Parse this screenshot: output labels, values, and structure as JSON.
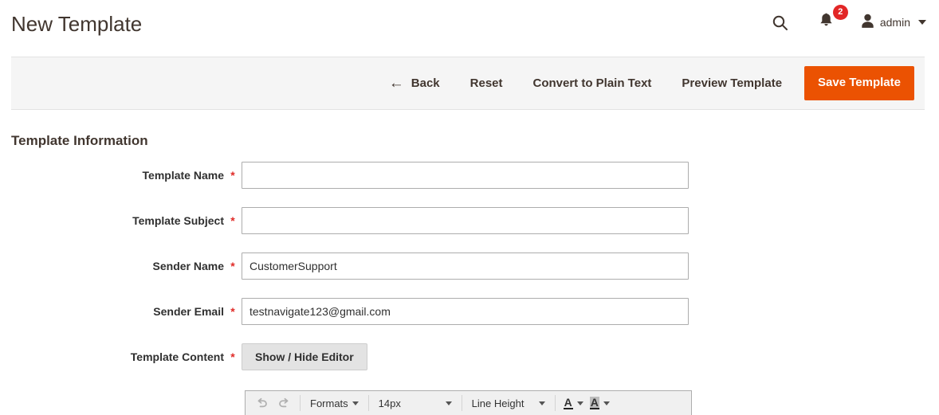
{
  "header": {
    "title": "New Template",
    "search_icon": "search-icon",
    "bell_icon": "bell-icon",
    "notification_count": "2",
    "user_icon": "user-avatar-icon",
    "user_name": "admin",
    "caret_icon": "chevron-down-icon"
  },
  "actions": {
    "back_arrow": "←",
    "back": "Back",
    "reset": "Reset",
    "convert": "Convert to Plain Text",
    "preview": "Preview Template",
    "save": "Save Template",
    "save_color": "#eb5202"
  },
  "form": {
    "section_title": "Template Information",
    "required_mark": "*",
    "fields": [
      {
        "label": "Template Name",
        "value": "",
        "placeholder": "",
        "required": "*"
      },
      {
        "label": "Template Subject",
        "value": "",
        "placeholder": "",
        "required": "*"
      },
      {
        "label": "Sender Name",
        "value": "CustomerSupport",
        "placeholder": "",
        "required": "*"
      },
      {
        "label": "Sender Email",
        "value": "testnavigate123@gmail.com",
        "placeholder": "",
        "required": "*"
      }
    ],
    "content_label": "Template Content",
    "content_required": "*",
    "show_hide_editor": "Show / Hide Editor"
  },
  "editor_toolbar": {
    "undo_icon": "undo-icon",
    "redo_icon": "redo-icon",
    "formats": "Formats",
    "font_size": "14px",
    "line_height": "Line Height",
    "text_color_icon": "text-color-icon",
    "background_color_icon": "background-color-icon"
  }
}
